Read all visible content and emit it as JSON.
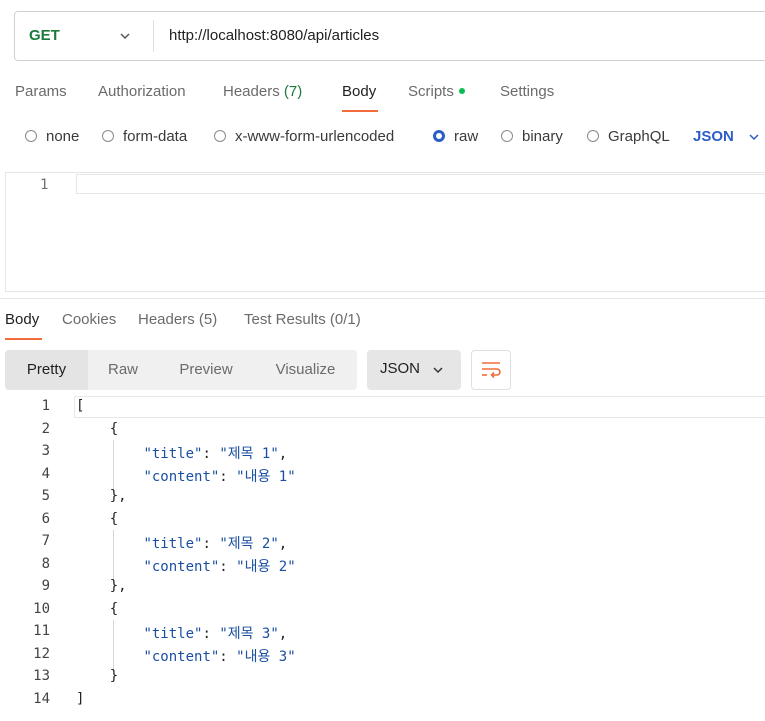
{
  "request": {
    "method": "GET",
    "url": "http://localhost:8080/api/articles",
    "tabs": [
      {
        "label": "Params",
        "count": ""
      },
      {
        "label": "Authorization",
        "count": ""
      },
      {
        "label": "Headers",
        "count": "(7)"
      },
      {
        "label": "Body",
        "count": ""
      },
      {
        "label": "Scripts",
        "count": ""
      },
      {
        "label": "Settings",
        "count": ""
      }
    ],
    "active_tab": "Body",
    "body_types": [
      "none",
      "form-data",
      "x-www-form-urlencoded",
      "raw",
      "binary",
      "GraphQL"
    ],
    "selected_body_type": "raw",
    "raw_format": "JSON",
    "editor_line_numbers": [
      "1"
    ]
  },
  "response": {
    "tabs": [
      {
        "label": "Body",
        "count": ""
      },
      {
        "label": "Cookies",
        "count": ""
      },
      {
        "label": "Headers",
        "count": "(5)"
      },
      {
        "label": "Test Results",
        "count": "(0/1)"
      }
    ],
    "views": [
      "Pretty",
      "Raw",
      "Preview",
      "Visualize"
    ],
    "active_view": "Pretty",
    "format": "JSON",
    "line_numbers": [
      "1",
      "2",
      "3",
      "4",
      "5",
      "6",
      "7",
      "8",
      "9",
      "10",
      "11",
      "12",
      "13",
      "14"
    ],
    "lines": [
      "[",
      "    {",
      "        \"title\": \"제목 1\",",
      "        \"content\": \"내용 1\"",
      "    },",
      "    {",
      "        \"title\": \"제목 2\",",
      "        \"content\": \"내용 2\"",
      "    },",
      "    {",
      "        \"title\": \"제목 3\",",
      "        \"content\": \"내용 3\"",
      "    }",
      "]"
    ]
  },
  "colors": {
    "accent": "#f26b3a",
    "method_get": "#1c7a3b",
    "selected_radio": "#2b5ec9",
    "scripts_dot": "#0cbb52"
  },
  "icons": {
    "method_dropdown": "chevron-down-icon",
    "format_dropdown": "chevron-down-icon",
    "wrap": "wrap-lines-icon"
  }
}
